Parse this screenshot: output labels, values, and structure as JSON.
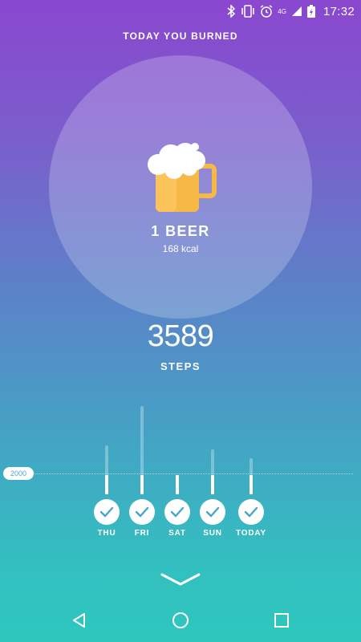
{
  "status_bar": {
    "time": "17:32",
    "network": "4G",
    "icons": [
      "bluetooth-icon",
      "vibrate-icon",
      "alarm-icon",
      "signal-icon",
      "battery-charging-icon"
    ]
  },
  "header": {
    "title": "TODAY YOU BURNED"
  },
  "burn": {
    "icon": "beer-mug-icon",
    "label": "1 BEER",
    "kcal": "168 kcal"
  },
  "steps": {
    "count": "3589",
    "label": "STEPS"
  },
  "history": {
    "goal_label": "2000",
    "days": [
      {
        "label": "THU",
        "completed": true
      },
      {
        "label": "FRI",
        "completed": true
      },
      {
        "label": "SAT",
        "completed": true
      },
      {
        "label": "SUN",
        "completed": true
      },
      {
        "label": "TODAY",
        "completed": true
      }
    ]
  },
  "colors": {
    "gradient_top": "#8a47cf",
    "gradient_bottom": "#2dc7bd",
    "beer": "#f7b945",
    "check": "#49a7c8"
  },
  "nav": {
    "back": "back-triangle-icon",
    "home": "home-circle-icon",
    "recents": "recents-square-icon"
  }
}
